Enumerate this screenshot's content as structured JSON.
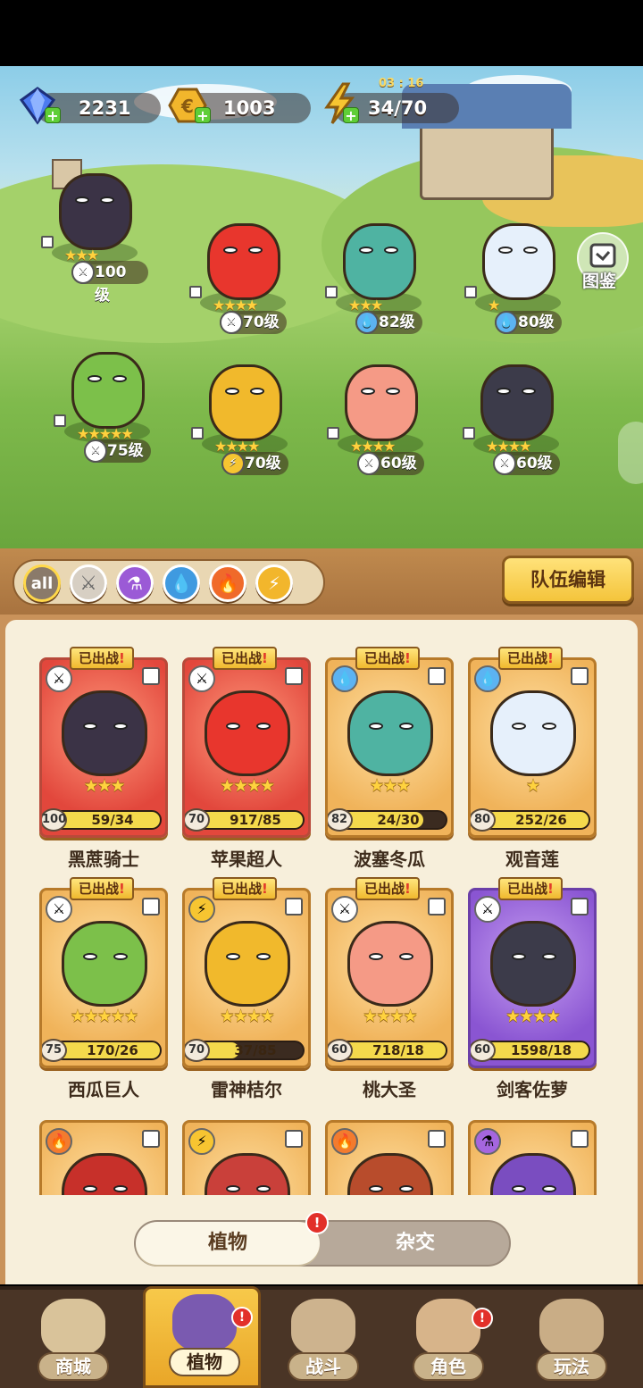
{
  "resources": {
    "gems": "2231",
    "coins": "1003",
    "energy": "34/70",
    "energy_timer": "03 : 16"
  },
  "guide": {
    "label": "图鉴"
  },
  "team_roster": [
    {
      "name": "黑蔗骑士",
      "level": "100级",
      "type_icon": "sword-icon",
      "stars": 3,
      "color": "#3b3346"
    },
    {
      "name": "苹果超人",
      "level": "70级",
      "type_icon": "sword-icon",
      "stars": 4,
      "color": "#e8362d"
    },
    {
      "name": "波塞冬瓜",
      "level": "82级",
      "type_icon": "water-icon",
      "stars": 3,
      "color": "#4fb3a2"
    },
    {
      "name": "观音莲",
      "level": "80级",
      "type_icon": "water-icon",
      "stars": 1,
      "color": "#e6f0fb"
    },
    {
      "name": "西瓜巨人",
      "level": "75级",
      "type_icon": "sword-icon",
      "stars": 5,
      "color": "#7cc04a"
    },
    {
      "name": "雷神桔尔",
      "level": "70级",
      "type_icon": "lightning-icon",
      "stars": 4,
      "color": "#f1b92c"
    },
    {
      "name": "桃大圣",
      "level": "60级",
      "type_icon": "sword-icon",
      "stars": 4,
      "color": "#f59a86"
    },
    {
      "name": "剑客佐萝",
      "level": "60级",
      "type_icon": "sword-icon",
      "stars": 4,
      "color": "#3c3b4a"
    }
  ],
  "filters": {
    "all_label": "all",
    "items": [
      "all",
      "sword-icon",
      "potion-icon",
      "water-icon",
      "fire-icon",
      "lightning-icon"
    ]
  },
  "team_edit_label": "队伍编辑",
  "deployed_label": "已出战",
  "cards": [
    {
      "name": "黑蔗骑士",
      "level": "100",
      "progress": "59/34",
      "fill": 1.0,
      "stars": 3,
      "frame": "red",
      "role": "sword-icon",
      "color": "#3b3346",
      "deployed": true
    },
    {
      "name": "苹果超人",
      "level": "70",
      "progress": "917/85",
      "fill": 1.0,
      "stars": 4,
      "frame": "red",
      "role": "sword-icon",
      "color": "#e8362d",
      "deployed": true
    },
    {
      "name": "波塞冬瓜",
      "level": "82",
      "progress": "24/30",
      "fill": 0.8,
      "stars": 3,
      "frame": "gold",
      "role": "water-icon",
      "color": "#4fb3a2",
      "deployed": true
    },
    {
      "name": "观音莲",
      "level": "80",
      "progress": "252/26",
      "fill": 1.0,
      "stars": 1,
      "frame": "gold",
      "role": "water-icon",
      "color": "#e6f0fb",
      "deployed": true
    },
    {
      "name": "西瓜巨人",
      "level": "75",
      "progress": "170/26",
      "fill": 1.0,
      "stars": 5,
      "frame": "gold",
      "role": "sword-icon",
      "color": "#7cc04a",
      "deployed": true
    },
    {
      "name": "雷神桔尔",
      "level": "70",
      "progress": "37/85",
      "fill": 0.44,
      "stars": 4,
      "frame": "gold",
      "role": "lightning-icon",
      "color": "#f1b92c",
      "deployed": true
    },
    {
      "name": "桃大圣",
      "level": "60",
      "progress": "718/18",
      "fill": 1.0,
      "stars": 4,
      "frame": "gold",
      "role": "sword-icon",
      "color": "#f59a86",
      "deployed": true
    },
    {
      "name": "剑客佐萝",
      "level": "60",
      "progress": "1598/18",
      "fill": 1.0,
      "stars": 4,
      "frame": "purple",
      "role": "sword-icon",
      "color": "#3c3b4a",
      "deployed": true
    },
    {
      "name": "",
      "frame": "gold",
      "role": "fire-icon",
      "color": "#c7302a"
    },
    {
      "name": "",
      "frame": "gold",
      "role": "lightning-icon",
      "color": "#c9403a"
    },
    {
      "name": "",
      "frame": "gold",
      "role": "fire-icon",
      "color": "#b84c2c"
    },
    {
      "name": "",
      "frame": "gold",
      "role": "potion-icon",
      "color": "#7a4dc0"
    }
  ],
  "segment": {
    "active": "植物",
    "other": "杂交",
    "badge": "!"
  },
  "nav": [
    {
      "label": "商城",
      "active": false,
      "badge": false
    },
    {
      "label": "植物",
      "active": true,
      "badge": true
    },
    {
      "label": "战斗",
      "active": false,
      "badge": false
    },
    {
      "label": "角色",
      "active": false,
      "badge": true
    },
    {
      "label": "玩法",
      "active": false,
      "badge": false
    }
  ],
  "badge_mark": "!",
  "colors": {
    "accent": "#f4c43b",
    "panel": "#f7efdb",
    "nav_bg": "#4a3526",
    "alert": "#e2302a"
  }
}
